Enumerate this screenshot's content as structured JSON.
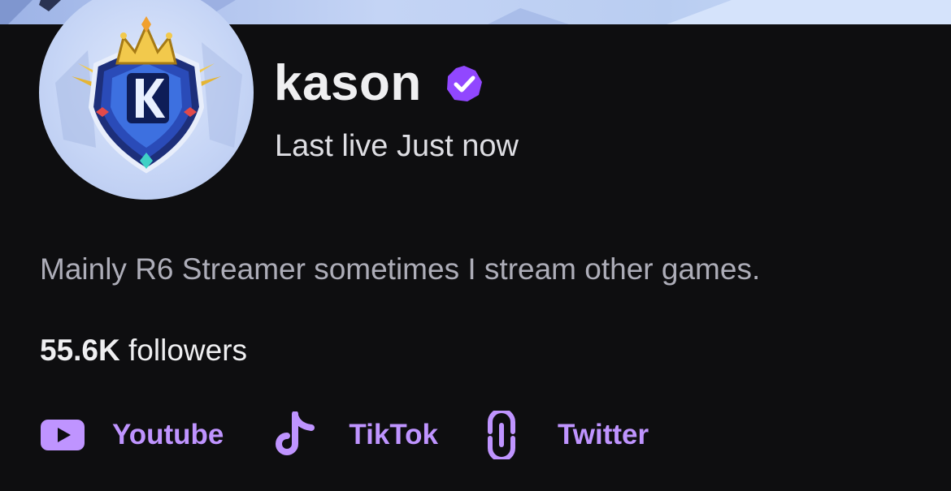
{
  "channel": {
    "name": "kason",
    "verified_icon": "verified-check-icon",
    "last_live": "Last live Just now",
    "bio": "Mainly R6 Streamer sometimes I stream other games.",
    "followers_count": "55.6K",
    "followers_label": "followers"
  },
  "links": [
    {
      "label": "Youtube",
      "icon": "youtube-icon"
    },
    {
      "label": "TikTok",
      "icon": "tiktok-icon"
    },
    {
      "label": "Twitter",
      "icon": "link-icon"
    }
  ],
  "colors": {
    "background": "#0e0e10",
    "accent": "#bf94ff",
    "verified": "#9147ff",
    "text_primary": "#efeff1",
    "text_secondary": "#adadb8"
  }
}
